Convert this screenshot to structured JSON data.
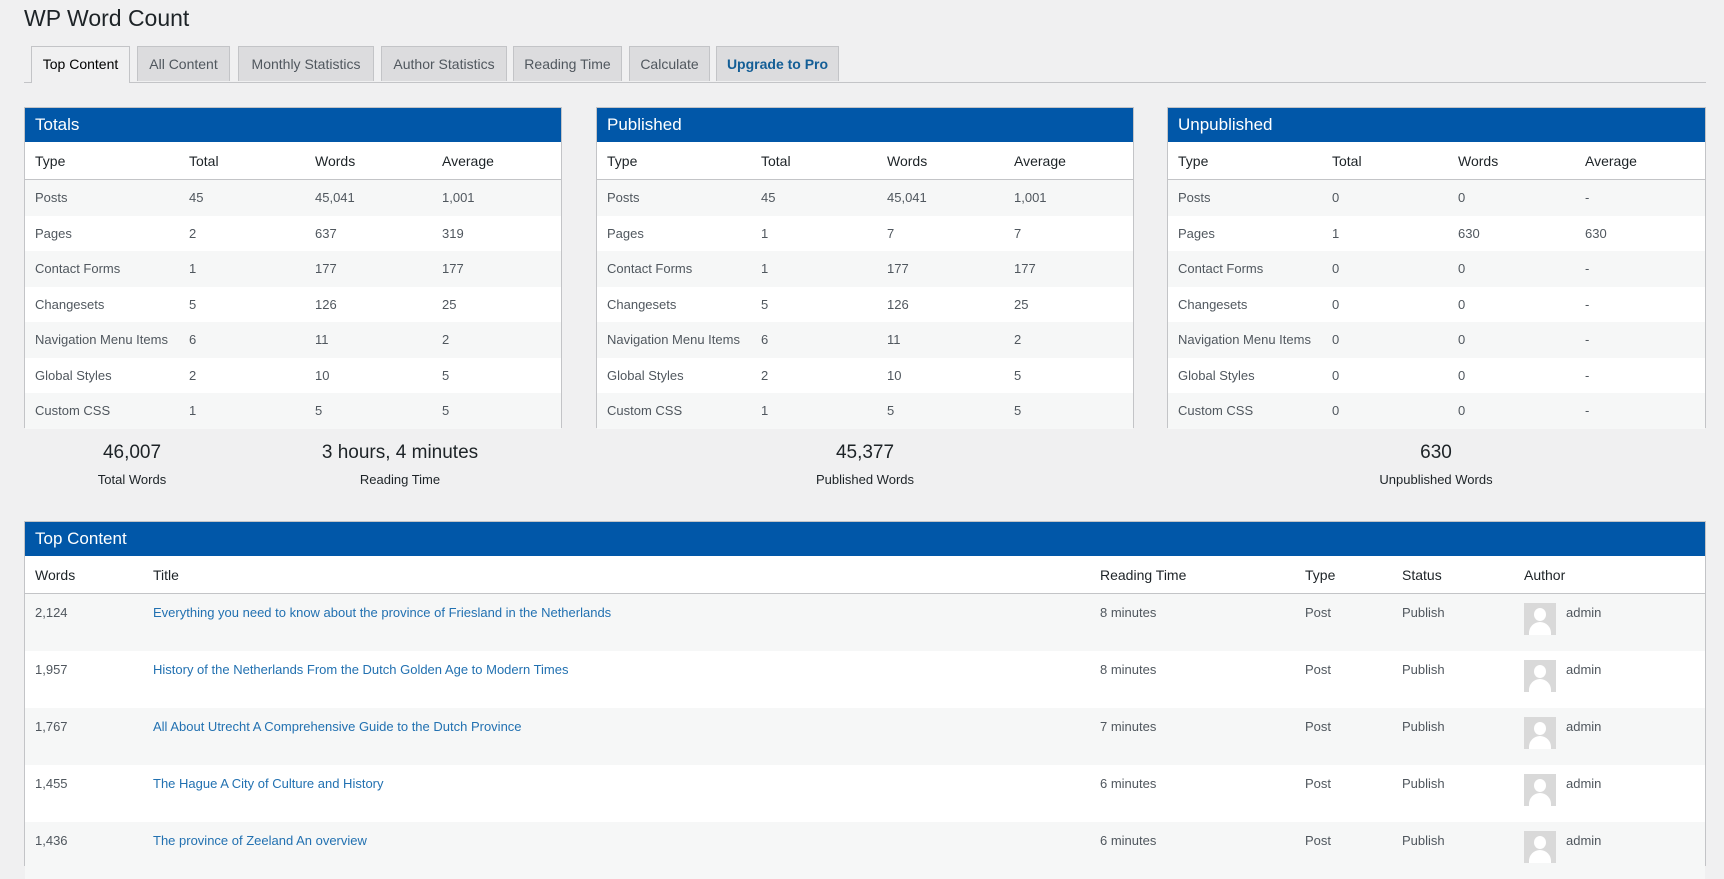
{
  "page": {
    "title": "WP Word Count"
  },
  "tabs": [
    "Top Content",
    "All Content",
    "Monthly Statistics",
    "Author Statistics",
    "Reading Time",
    "Calculate",
    "Upgrade to Pro"
  ],
  "columns": {
    "type": "Type",
    "total": "Total",
    "words": "Words",
    "average": "Average"
  },
  "totals": {
    "title": "Totals",
    "rows": [
      [
        "Posts",
        "45",
        "45,041",
        "1,001"
      ],
      [
        "Pages",
        "2",
        "637",
        "319"
      ],
      [
        "Contact Forms",
        "1",
        "177",
        "177"
      ],
      [
        "Changesets",
        "5",
        "126",
        "25"
      ],
      [
        "Navigation Menu Items",
        "6",
        "11",
        "2"
      ],
      [
        "Global Styles",
        "2",
        "10",
        "5"
      ],
      [
        "Custom CSS",
        "1",
        "5",
        "5"
      ]
    ]
  },
  "published": {
    "title": "Published",
    "rows": [
      [
        "Posts",
        "45",
        "45,041",
        "1,001"
      ],
      [
        "Pages",
        "1",
        "7",
        "7"
      ],
      [
        "Contact Forms",
        "1",
        "177",
        "177"
      ],
      [
        "Changesets",
        "5",
        "126",
        "25"
      ],
      [
        "Navigation Menu Items",
        "6",
        "11",
        "2"
      ],
      [
        "Global Styles",
        "2",
        "10",
        "5"
      ],
      [
        "Custom CSS",
        "1",
        "5",
        "5"
      ]
    ]
  },
  "unpublished": {
    "title": "Unpublished",
    "rows": [
      [
        "Posts",
        "0",
        "0",
        "-"
      ],
      [
        "Pages",
        "1",
        "630",
        "630"
      ],
      [
        "Contact Forms",
        "0",
        "0",
        "-"
      ],
      [
        "Changesets",
        "0",
        "0",
        "-"
      ],
      [
        "Navigation Menu Items",
        "0",
        "0",
        "-"
      ],
      [
        "Global Styles",
        "0",
        "0",
        "-"
      ],
      [
        "Custom CSS",
        "0",
        "0",
        "-"
      ]
    ]
  },
  "stats": {
    "total_words": {
      "value": "46,007",
      "label": "Total Words"
    },
    "reading_time": {
      "value": "3 hours, 4 minutes",
      "label": "Reading Time"
    },
    "published_words": {
      "value": "45,377",
      "label": "Published Words"
    },
    "unpublished_words": {
      "value": "630",
      "label": "Unpublished Words"
    }
  },
  "top_content": {
    "title": "Top Content",
    "headers": [
      "Words",
      "Title",
      "Reading Time",
      "Type",
      "Status",
      "Author"
    ],
    "rows": [
      {
        "words": "2,124",
        "title": "Everything you need to know about the province of Friesland in the Netherlands",
        "reading_time": "8 minutes",
        "type": "Post",
        "status": "Publish",
        "author": "admin"
      },
      {
        "words": "1,957",
        "title": "History of the Netherlands From the Dutch Golden Age to Modern Times",
        "reading_time": "8 minutes",
        "type": "Post",
        "status": "Publish",
        "author": "admin"
      },
      {
        "words": "1,767",
        "title": "All About Utrecht A Comprehensive Guide to the Dutch Province",
        "reading_time": "7 minutes",
        "type": "Post",
        "status": "Publish",
        "author": "admin"
      },
      {
        "words": "1,455",
        "title": "The Hague A City of Culture and History",
        "reading_time": "6 minutes",
        "type": "Post",
        "status": "Publish",
        "author": "admin"
      },
      {
        "words": "1,436",
        "title": "The province of Zeeland An overview",
        "reading_time": "6 minutes",
        "type": "Post",
        "status": "Publish",
        "author": "admin"
      }
    ]
  },
  "colors": {
    "header_blue": "#0157a8",
    "link": "#2271b1",
    "pro_tab": "#135e96",
    "background": "#f0f0f1"
  }
}
